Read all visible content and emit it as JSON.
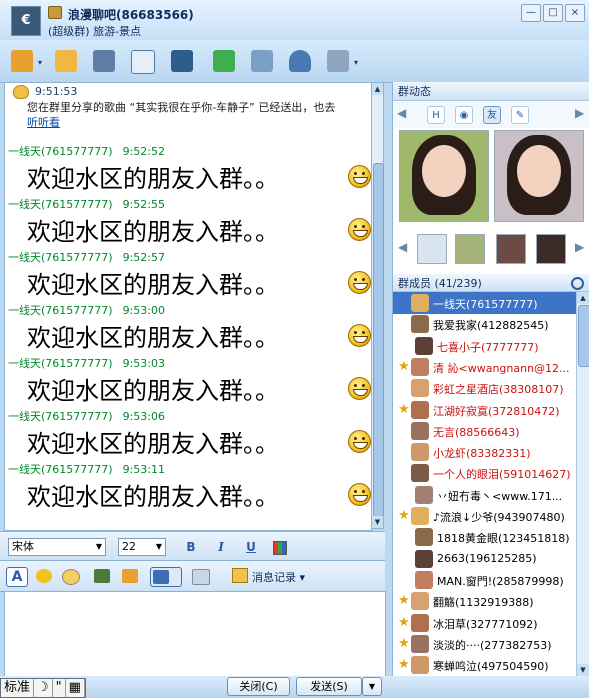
{
  "window": {
    "title": "浪漫聊吧(86683566)",
    "subtitle": "(超级群) 旅游-景点",
    "minimize": "—",
    "maximize": "□",
    "close": "×"
  },
  "toolbar": {
    "icons": [
      "group-home-icon",
      "folder-share-icon",
      "group-album-icon",
      "group-card-icon",
      "group-game-icon",
      "group-notice-icon",
      "group-settings-icon",
      "group-member-icon",
      "more-apps-icon"
    ]
  },
  "chat": {
    "system": {
      "time": "9:51:53",
      "text": "您在群里分享的歌曲 “其实我很在乎你-车静子” 已经送出，也去",
      "link": "听听看"
    },
    "messages": [
      {
        "sender": "一线天(761577777)",
        "time": "9:52:52",
        "text": "欢迎水区的朋友入群。。"
      },
      {
        "sender": "一线天(761577777)",
        "time": "9:52:55",
        "text": "欢迎水区的朋友入群。。"
      },
      {
        "sender": "一线天(761577777)",
        "time": "9:52:57",
        "text": "欢迎水区的朋友入群。。"
      },
      {
        "sender": "一线天(761577777)",
        "time": "9:53:00",
        "text": "欢迎水区的朋友入群。。"
      },
      {
        "sender": "一线天(761577777)",
        "time": "9:53:03",
        "text": "欢迎水区的朋友入群。。"
      },
      {
        "sender": "一线天(761577777)",
        "time": "9:53:06",
        "text": "欢迎水区的朋友入群。。"
      },
      {
        "sender": "一线天(761577777)",
        "time": "9:53:11",
        "text": "欢迎水区的朋友入群。。"
      }
    ]
  },
  "format": {
    "font": "宋体",
    "size": "22",
    "bold": "B",
    "italic": "I",
    "underline": "U"
  },
  "input_toolbar": {
    "record_label": "消息记录"
  },
  "bottom": {
    "ime": [
      "标准",
      "☽",
      "\"",
      "▦"
    ],
    "close_label": "关闭(C)",
    "send_label": "发送(S)"
  },
  "dynamics": {
    "title": "群动态",
    "tabs": [
      "H",
      "◉",
      "友",
      "✎"
    ]
  },
  "members": {
    "title": "群成员 (41/239)",
    "list": [
      {
        "name": "一线天(761577777)",
        "color": "#ffffff",
        "star": false,
        "selected": true
      },
      {
        "name": "我爱我家(412882545)",
        "color": "#000000",
        "star": false,
        "selected": false
      },
      {
        "name": "七喜小子(7777777)",
        "color": "#cc1111",
        "star": false,
        "selected": false
      },
      {
        "name": "清 訫<wwangnann@12...",
        "color": "#cc1111",
        "star": true,
        "selected": false
      },
      {
        "name": "彩虹之星酒店(38308107)",
        "color": "#cc1111",
        "star": false,
        "selected": false
      },
      {
        "name": "江湖好寂寞(372810472)",
        "color": "#cc1111",
        "star": true,
        "selected": false
      },
      {
        "name": "无言(88566643)",
        "color": "#cc1111",
        "star": false,
        "selected": false
      },
      {
        "name": "小龙虾(83382331)",
        "color": "#cc1111",
        "star": false,
        "selected": false
      },
      {
        "name": "一个人的眼泪(591014627)",
        "color": "#cc1111",
        "star": false,
        "selected": false
      },
      {
        "name": "丷妞冇毒丶<www.171...",
        "color": "#000000",
        "star": false,
        "selected": false
      },
      {
        "name": "♪流浪↓少爷(943907480)",
        "color": "#000000",
        "star": true,
        "selected": false
      },
      {
        "name": "1818黄金眼(123451818)",
        "color": "#000000",
        "star": false,
        "selected": false
      },
      {
        "name": "2663(196125285)",
        "color": "#000000",
        "star": false,
        "selected": false
      },
      {
        "name": "MAN.窗門!(285879998)",
        "color": "#000000",
        "star": false,
        "selected": false
      },
      {
        "name": "翻觞(1132919388)",
        "color": "#000000",
        "star": true,
        "selected": false
      },
      {
        "name": "冰泪草(327771092)",
        "color": "#000000",
        "star": true,
        "selected": false
      },
      {
        "name": "淡淡的····(277382753)",
        "color": "#000000",
        "star": true,
        "selected": false
      },
      {
        "name": "寒蝉鸣泣(497504590)",
        "color": "#000000",
        "star": true,
        "selected": false
      }
    ]
  }
}
